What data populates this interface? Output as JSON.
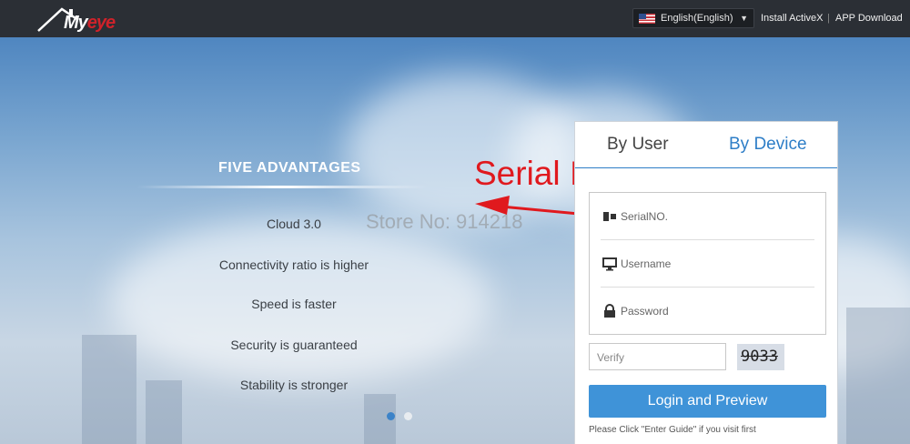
{
  "header": {
    "logo_text": "Myeye",
    "language": "English(English)",
    "install_label": "Install ActiveX",
    "separator": "|",
    "app_download_label": "APP Download"
  },
  "advantages": {
    "title": "FIVE ADVANTAGES",
    "items": [
      "Cloud 3.0",
      "Connectivity ratio is higher",
      "Speed is faster",
      "Security is guaranteed",
      "Stability is stronger"
    ]
  },
  "overlay": {
    "watermark": "Store No: 914218",
    "annotation": "Serial ID"
  },
  "login_panel": {
    "tabs": [
      {
        "label": "By User",
        "active": false
      },
      {
        "label": "By Device",
        "active": true
      }
    ],
    "fields": [
      {
        "icon": "serial-icon",
        "placeholder": "SerialNO."
      },
      {
        "icon": "monitor-icon",
        "placeholder": "Username"
      },
      {
        "icon": "lock-icon",
        "placeholder": "Password"
      }
    ],
    "verify_placeholder": "Verify",
    "captcha_code": "9033",
    "login_button": "Login and Preview",
    "hint": "Please Click \"Enter Guide\" if you visit first"
  },
  "carousel": {
    "count": 2,
    "active_index": 0
  },
  "colors": {
    "topbar": "#2b2f35",
    "accent_blue": "#2e7ec7",
    "button_blue": "#3f93d8",
    "annotation_red": "#e0191e"
  }
}
